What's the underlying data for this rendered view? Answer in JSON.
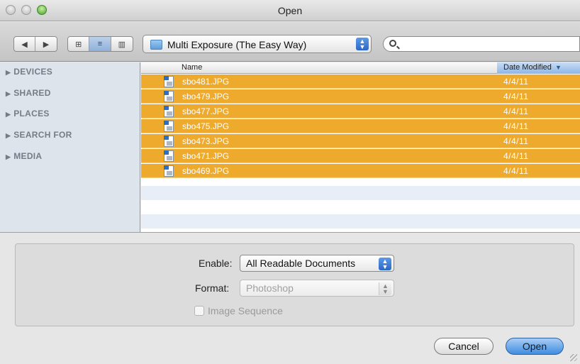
{
  "window": {
    "title": "Open"
  },
  "toolbar": {
    "back_icon": "chevron-left-icon",
    "forward_icon": "chevron-right-icon",
    "view_icons": [
      "icon-view-icon",
      "list-view-icon",
      "column-view-icon"
    ],
    "location": "Multi Exposure (The Easy Way)",
    "search_placeholder": ""
  },
  "sidebar": {
    "items": [
      {
        "label": "DEVICES"
      },
      {
        "label": "SHARED"
      },
      {
        "label": "PLACES"
      },
      {
        "label": "SEARCH FOR"
      },
      {
        "label": "MEDIA"
      }
    ]
  },
  "file_list": {
    "columns": {
      "name": "Name",
      "date": "Date Modified"
    },
    "sort_indicator": "▼",
    "files": [
      {
        "name": "sbo481.JPG",
        "date": "4/4/11"
      },
      {
        "name": "sbo479.JPG",
        "date": "4/4/11"
      },
      {
        "name": "sbo477.JPG",
        "date": "4/4/11"
      },
      {
        "name": "sbo475.JPG",
        "date": "4/4/11"
      },
      {
        "name": "sbo473.JPG",
        "date": "4/4/11"
      },
      {
        "name": "sbo471.JPG",
        "date": "4/4/11"
      },
      {
        "name": "sbo469.JPG",
        "date": "4/4/11"
      }
    ]
  },
  "options": {
    "enable_label": "Enable:",
    "enable_value": "All Readable Documents",
    "format_label": "Format:",
    "format_value": "Photoshop",
    "image_sequence_label": "Image Sequence"
  },
  "buttons": {
    "cancel": "Cancel",
    "open": "Open"
  },
  "colors": {
    "selection": "#eeaa2c",
    "accent": "#3e8de1",
    "sidebar_bg": "#dee4ec"
  }
}
